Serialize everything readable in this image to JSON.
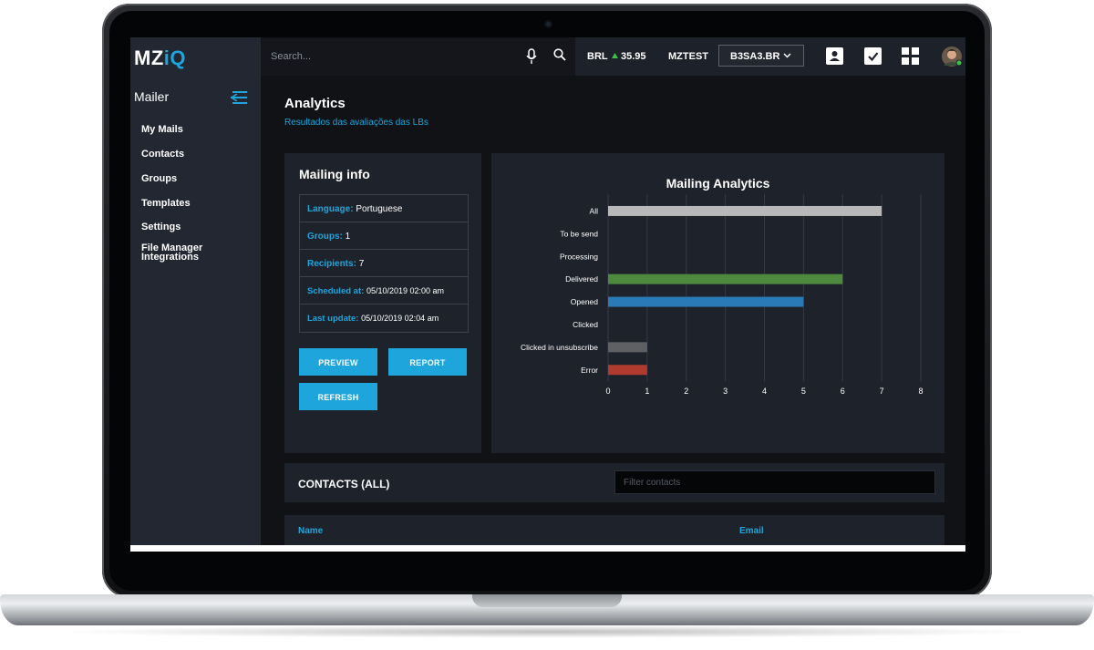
{
  "app": {
    "logo_main": "MZ",
    "logo_accent": "iQ"
  },
  "sidebar": {
    "title": "Mailer",
    "items": [
      {
        "label": "My Mails"
      },
      {
        "label": "Contacts"
      },
      {
        "label": "Groups"
      },
      {
        "label": "Templates"
      },
      {
        "label": "Settings"
      },
      {
        "label": "File Manager"
      },
      {
        "label": "Integrations"
      }
    ]
  },
  "topbar": {
    "search_placeholder": "Search...",
    "currency": "BRL",
    "currency_value": "35.95",
    "account": "MZTEST",
    "ticker_selected": "B3SA3.BR",
    "icons": [
      "microphone-icon",
      "search-icon",
      "contact-card-icon",
      "checkbox-icon",
      "grid-icon",
      "avatar"
    ]
  },
  "page": {
    "title": "Analytics",
    "subtitle": "Resultados das avaliações das LBs"
  },
  "mailing_info": {
    "title": "Mailing info",
    "rows": [
      {
        "key": "Language:",
        "value": "Portuguese"
      },
      {
        "key": "Groups:",
        "value": "1"
      },
      {
        "key": "Recipients:",
        "value": "7"
      },
      {
        "key": "Scheduled at:",
        "value": "05/10/2019 02:00 am"
      },
      {
        "key": "Last update:",
        "value": "05/10/2019 02:04 am"
      }
    ],
    "buttons": {
      "preview": "PREVIEW",
      "report": "REPORT",
      "refresh": "REFRESH"
    }
  },
  "chart_data": {
    "type": "bar",
    "orientation": "horizontal",
    "title": "Mailing Analytics",
    "categories": [
      "All",
      "To be send",
      "Processing",
      "Delivered",
      "Opened",
      "Clicked",
      "Clicked in unsubscribe",
      "Error"
    ],
    "values": [
      7,
      0,
      0,
      6,
      5,
      0,
      1,
      1
    ],
    "colors": [
      "#b8b8b8",
      "#b8b8b8",
      "#b8b8b8",
      "#4e8a3e",
      "#2a7ab8",
      "#b8b8b8",
      "#5f6064",
      "#b03a2e"
    ],
    "xlim": [
      0,
      8
    ],
    "xticks": [
      0,
      1,
      2,
      3,
      4,
      5,
      6,
      7,
      8
    ],
    "grid": true,
    "xlabel": "",
    "ylabel": ""
  },
  "contacts": {
    "title": "CONTACTS (ALL)",
    "filter_placeholder": "Filter contacts",
    "columns": [
      "Name",
      "Email"
    ]
  }
}
